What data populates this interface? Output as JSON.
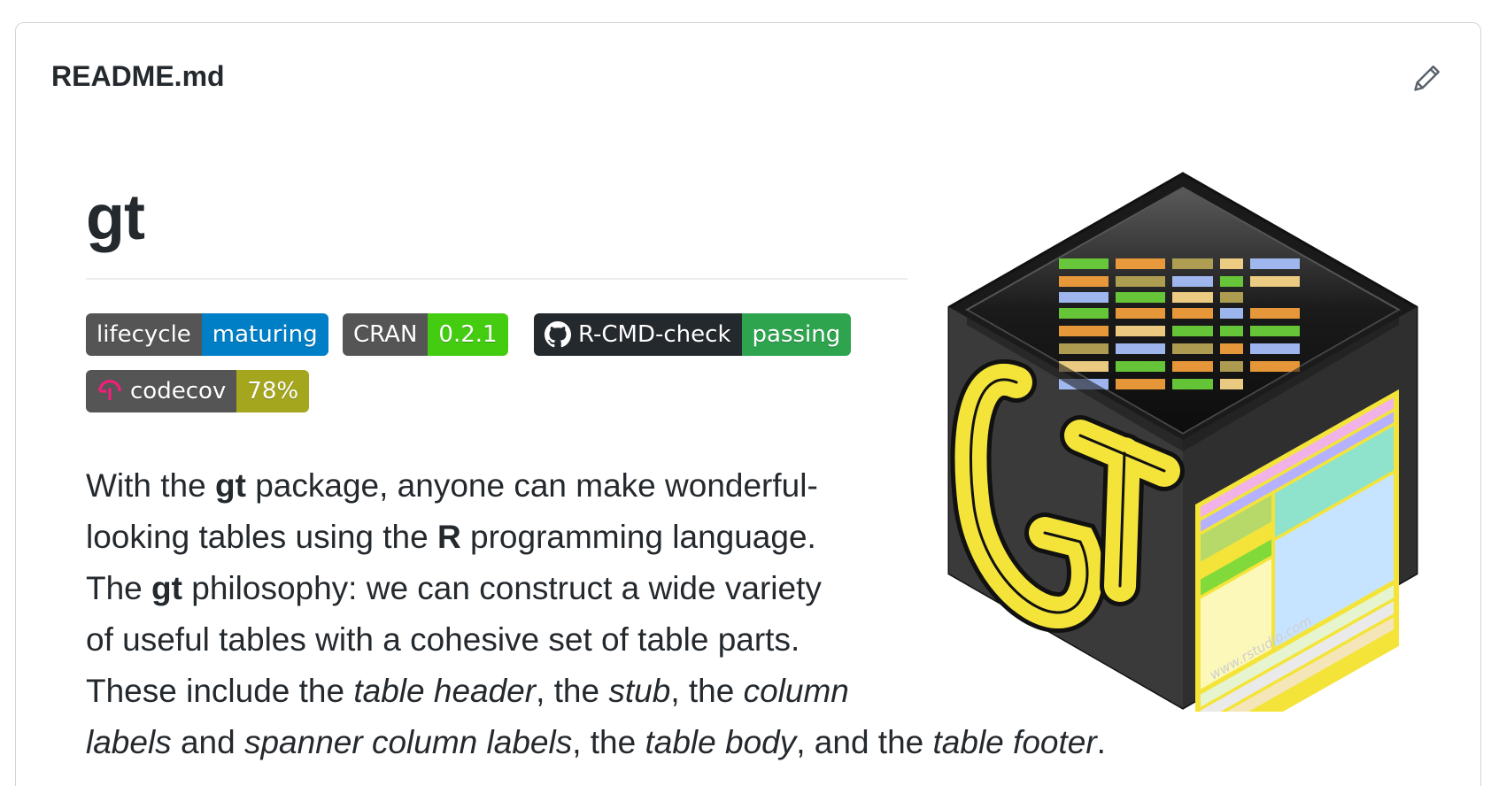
{
  "file": {
    "name": "README.md"
  },
  "heading": "gt",
  "badges": [
    {
      "label": "lifecycle",
      "value": "maturing",
      "color": "#007ec6"
    },
    {
      "label": "CRAN",
      "value": "0.2.1",
      "color": "#4c1"
    },
    {
      "label": "R-CMD-check",
      "value": "passing",
      "color": "#2ea44f",
      "icon": "github-icon"
    },
    {
      "label": "codecov",
      "value": "78%",
      "color": "#a4a61d",
      "icon": "codecov-icon"
    }
  ],
  "intro": {
    "l1a": "With the ",
    "l1b": "gt",
    "l1c": " package, anyone can make wonderful-",
    "l2a": "looking tables using the ",
    "l2b": "R",
    "l2c": " programming language.",
    "l3a": "The ",
    "l3b": "gt",
    "l3c": " philosophy: we can construct a wide variety",
    "l4": "of useful tables with a cohesive set of table parts.",
    "l5a": "These include the ",
    "l5b": "table header",
    "l5c": ", the ",
    "l5d": "stub",
    "l5e": ", the ",
    "l5f": "column",
    "l6a": "labels",
    "l6b": " and ",
    "l6c": "spanner column labels",
    "l6d": ", the ",
    "l6e": "table body",
    "l6f": ", and the ",
    "l6g": "table footer",
    "l6h": "."
  },
  "logo": {
    "watermark": "www.rstudio.com",
    "letters": "GT"
  }
}
